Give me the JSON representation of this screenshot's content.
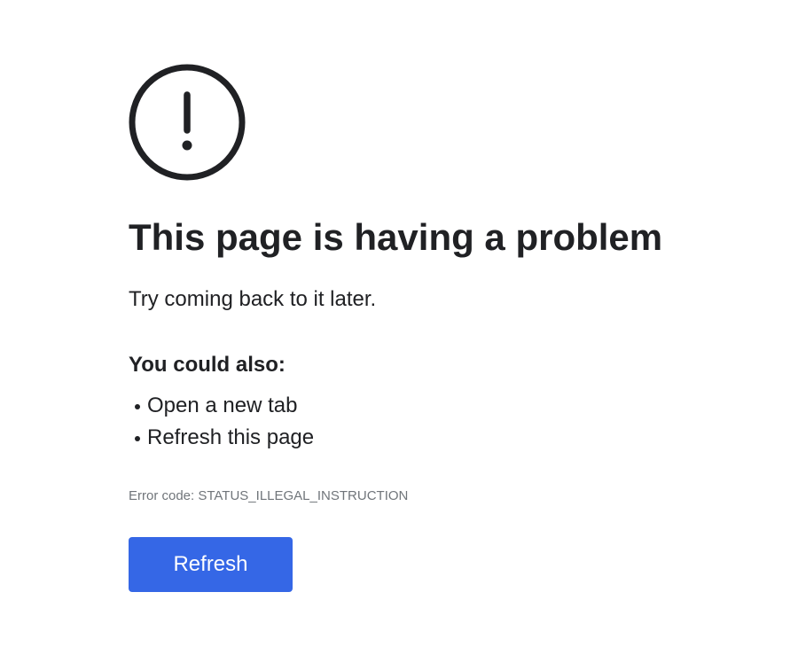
{
  "error_page": {
    "icon": "exclamation-circle-icon",
    "title": "This page is having a problem",
    "subtitle": "Try coming back to it later.",
    "also_heading": "You could also:",
    "suggestions": [
      "Open a new tab",
      "Refresh this page"
    ],
    "error_code": "Error code: STATUS_ILLEGAL_INSTRUCTION",
    "refresh_label": "Refresh"
  },
  "colors": {
    "text": "#202124",
    "muted": "#70757a",
    "button": "#3567e6",
    "button_text": "#ffffff"
  }
}
